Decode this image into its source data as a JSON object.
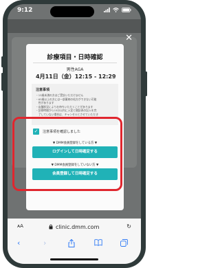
{
  "status_bar": {
    "time": "9:12"
  },
  "modal": {
    "title": "診療項目・日時確認",
    "course": "男性AGA",
    "datetime": "4月11日（金）12:15 - 12:29",
    "datetime_note": "時",
    "notes_title": "注意事項",
    "notes": [
      "・15歳未満の方はご受診いただけません",
      "・65歳以上の方には一部薬剤の処方ができない可能",
      "　性があります",
      "・店舗状況によりお待ちいただくことがあります",
      "・診察時間から15分以内に入室と間診表の記入を完",
      "　了していない場合は、キャンセルとさせていただき"
    ],
    "checkbox_label": "注意事項を確認しました",
    "checkbox_checked": true,
    "member_head": "▼ DMM会員登録をしている方 ▼",
    "login_button": "ログインして日時確定する",
    "nonmember_head": "▼ DMM会員登録をしていない方 ▼",
    "register_button": "会員登録して日時確定する"
  },
  "browser": {
    "aa_label": "ᴀA",
    "url": "clinic.dmm.com"
  },
  "colors": {
    "accent": "#20b2b7",
    "highlight": "#e0262e",
    "browser_icon": "#2f7af5"
  }
}
